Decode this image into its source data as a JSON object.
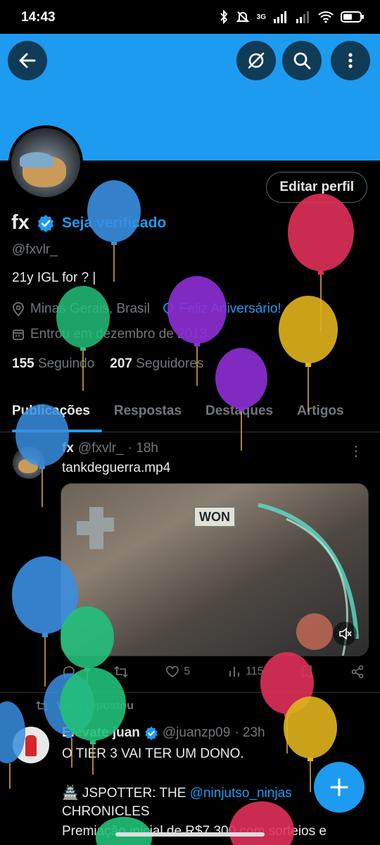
{
  "status_bar": {
    "time": "14:43",
    "network": "3G"
  },
  "header": {
    "back_icon": "arrow-left-icon",
    "gifts_icon": "no-gift-icon",
    "search_icon": "search-icon",
    "more_icon": "more-vertical-icon"
  },
  "profile": {
    "name": "fx",
    "get_verified": "Seja verificado",
    "handle": "@fxvlr_",
    "bio": "21y IGL for ? |",
    "location": "Minas Gerais, Brasil",
    "birthday": "Feliz Aniversário!",
    "joined": "Entrou em dezembro de 2013",
    "following_count": "155",
    "following_label": "Seguindo",
    "followers_count": "207",
    "followers_label": "Seguidores",
    "edit_button": "Editar perfil"
  },
  "tabs": [
    "Publicações",
    "Respostas",
    "Destaques",
    "Artigos"
  ],
  "post": {
    "name": "fx",
    "handle": "@fxvlr_",
    "time": "· 18h",
    "text": "tankdeguerra.mp4",
    "media_badge": "WON",
    "likes": "5",
    "views": "115"
  },
  "repost": {
    "label": "Você repostou",
    "name": "Elevate juan",
    "handle": "@juanzp09",
    "time": "· 23h",
    "line1": "O TIER 3 VAI TER UM DONO.",
    "line2_prefix": "🏯 JSPOTTER: THE ",
    "line2_mention": "@ninjutso_ninjas",
    "line3": "CHRONICLES",
    "line4": "Premiação inicial de R$7.300 com sorteios e"
  },
  "colors": {
    "accent": "#1d9bf0",
    "background": "#000000",
    "muted": "#71767b"
  }
}
